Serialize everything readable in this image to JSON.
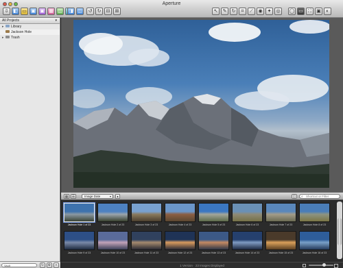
{
  "window": {
    "title": "Aperture"
  },
  "toolbar": {
    "left_buttons": [
      {
        "icon": "import-arrow-icon",
        "glyph": "⇩",
        "style": "plain"
      },
      {
        "icon": "new-project-icon",
        "glyph": "◧",
        "style": "c-blue"
      },
      {
        "icon": "new-folder-icon",
        "glyph": "▭",
        "style": "c-yellow"
      },
      {
        "icon": "new-album-icon",
        "glyph": "▣",
        "style": "c-blue"
      },
      {
        "icon": "smart-album-icon",
        "glyph": "▣",
        "style": "c-purple"
      },
      {
        "icon": "light-table-icon",
        "glyph": "▦",
        "style": "c-pink"
      },
      {
        "icon": "web-gallery-icon",
        "glyph": "◫",
        "style": "c-green"
      },
      {
        "icon": "book-icon",
        "glyph": "▤",
        "style": "c-teal"
      }
    ],
    "mid_buttons": [
      {
        "icon": "stack-icon",
        "glyph": "◨",
        "style": "c-blue"
      },
      {
        "icon": "compare-icon",
        "glyph": "◫",
        "style": "c-blue"
      }
    ],
    "rotate_buttons": [
      {
        "icon": "rotate-left-icon",
        "glyph": "↺",
        "style": "plain"
      },
      {
        "icon": "rotate-right-icon",
        "glyph": "↻",
        "style": "plain"
      }
    ],
    "mid2_buttons": [
      {
        "icon": "show-master-icon",
        "glyph": "⊟",
        "style": "plain"
      },
      {
        "icon": "new-version-icon",
        "glyph": "⊞",
        "style": "plain"
      }
    ],
    "tool_buttons": [
      {
        "icon": "selection-tool-icon",
        "glyph": "↖",
        "style": "plain"
      },
      {
        "icon": "lift-stamp-icon",
        "glyph": "✎",
        "style": "plain"
      },
      {
        "icon": "rotate-tool-icon",
        "glyph": "↻",
        "style": "plain"
      },
      {
        "icon": "crop-tool-icon",
        "glyph": "⌗",
        "style": "plain"
      },
      {
        "icon": "straighten-tool-icon",
        "glyph": "⟋",
        "style": "plain"
      },
      {
        "icon": "red-eye-tool-icon",
        "glyph": "◉",
        "style": "plain"
      },
      {
        "icon": "spot-patch-tool-icon",
        "glyph": "✦",
        "style": "plain"
      },
      {
        "icon": "loupe-tool-icon",
        "glyph": "◎",
        "style": "plain"
      }
    ],
    "view_buttons": [
      {
        "icon": "loupe-icon",
        "glyph": "◯",
        "style": "plain"
      },
      {
        "icon": "primary-only-icon",
        "glyph": "▭",
        "style": "dark"
      },
      {
        "icon": "fullscreen-icon",
        "glyph": "⛶",
        "style": "plain"
      },
      {
        "icon": "viewer-mode-icon",
        "glyph": "▣",
        "style": "plain"
      },
      {
        "icon": "adjustments-icon",
        "glyph": "◐",
        "style": "plain"
      }
    ]
  },
  "sidebar": {
    "header": "All Projects",
    "items": [
      {
        "label": "Library",
        "type": "folder",
        "expanded": false
      },
      {
        "label": "Jackson Hole",
        "type": "project",
        "selected": true
      },
      {
        "label": "Trash",
        "type": "folder",
        "expanded": false
      }
    ],
    "footer": {
      "search_label": "Vault"
    }
  },
  "filmstrip": {
    "sort_label": "Image Date",
    "search_placeholder": "Shortcut or Filter",
    "status": "1 Version · 23 Images Displayed",
    "thumbnails": [
      {
        "caption": "Jackson Hole 1 of 23",
        "selected": true,
        "sky": "#3e72ad",
        "mid": "#8b98a3",
        "ground": "#3a4434"
      },
      {
        "caption": "Jackson Hole 2 of 23",
        "selected": false,
        "sky": "#4d81c1",
        "mid": "#9aa4ad",
        "ground": "#39412f"
      },
      {
        "caption": "Jackson Hole 3 of 23",
        "selected": false,
        "sky": "#79a1cf",
        "mid": "#8a7a5e",
        "ground": "#4b3f2e"
      },
      {
        "caption": "Jackson Hole 4 of 23",
        "selected": false,
        "sky": "#6b96c9",
        "mid": "#8b5f44",
        "ground": "#5b4630"
      },
      {
        "caption": "Jackson Hole 5 of 23",
        "selected": false,
        "sky": "#3b77c2",
        "mid": "#a3a69b",
        "ground": "#5c6a4a"
      },
      {
        "caption": "Jackson Hole 6 of 23",
        "selected": false,
        "sky": "#6a90b6",
        "mid": "#8e8a76",
        "ground": "#747047"
      },
      {
        "caption": "Jackson Hole 7 of 23",
        "selected": false,
        "sky": "#5a87bb",
        "mid": "#a39c8a",
        "ground": "#6a6a52"
      },
      {
        "caption": "Jackson Hole 8 of 23",
        "selected": false,
        "sky": "#4a7db8",
        "mid": "#8e9482",
        "ground": "#7a7444"
      },
      {
        "caption": "Jackson Hole 9 of 23",
        "selected": false,
        "sky": "#2d4f86",
        "mid": "#7a8aa8",
        "ground": "#1e2b40"
      },
      {
        "caption": "Jackson Hole 10 of 23",
        "selected": false,
        "sky": "#5a6b9a",
        "mid": "#c2a2b8",
        "ground": "#3a3f58"
      },
      {
        "caption": "Jackson Hole 11 of 23",
        "selected": false,
        "sky": "#30415e",
        "mid": "#a58a6e",
        "ground": "#2a2a33"
      },
      {
        "caption": "Jackson Hole 12 of 23",
        "selected": false,
        "sky": "#1f3356",
        "mid": "#d89a5e",
        "ground": "#2c2b35"
      },
      {
        "caption": "Jackson Hole 13 of 23",
        "selected": false,
        "sky": "#3c5986",
        "mid": "#c48a62",
        "ground": "#2e3646"
      },
      {
        "caption": "Jackson Hole 14 of 23",
        "selected": false,
        "sky": "#25406e",
        "mid": "#7f9bc2",
        "ground": "#1d2840"
      },
      {
        "caption": "Jackson Hole 15 of 23",
        "selected": false,
        "sky": "#4a3a2a",
        "mid": "#d9a05a",
        "ground": "#5a3f22"
      },
      {
        "caption": "Jackson Hole 16 of 23",
        "selected": false,
        "sky": "#2e5d9a",
        "mid": "#7aa0c8",
        "ground": "#243a5a"
      }
    ]
  },
  "colors": {
    "accent": "#6b8fd6",
    "window_bg": "#1c1c1c",
    "viewer_bg": "#5a5a5a"
  }
}
